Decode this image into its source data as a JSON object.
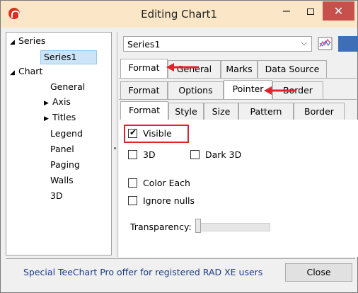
{
  "window": {
    "title": "Editing Chart1",
    "minimize_glyph": "−",
    "close_glyph": "✕",
    "icon": "teechart-app-icon"
  },
  "tree": {
    "series_root": "Series",
    "series1": "Series1",
    "chart_root": "Chart",
    "chart_items": [
      "General",
      "Axis",
      "Titles",
      "Legend",
      "Panel",
      "Paging",
      "Walls",
      "3D"
    ]
  },
  "series_select": {
    "value": "Series1"
  },
  "tabs_level1": [
    "Format",
    "General",
    "Marks",
    "Data Source"
  ],
  "tabs_level2": [
    "Format",
    "Options",
    "Pointer",
    "Border"
  ],
  "tabs_level3": [
    "Format",
    "Style",
    "Size",
    "Pattern",
    "Border"
  ],
  "checkboxes": {
    "visible": {
      "label": "Visible",
      "checked": true
    },
    "three_d": {
      "label": "3D",
      "checked": false
    },
    "dark_3d": {
      "label": "Dark 3D",
      "checked": false
    },
    "color_each": {
      "label": "Color Each",
      "checked": false
    },
    "ignore_nulls": {
      "label": "Ignore nulls",
      "checked": false
    }
  },
  "transparency": {
    "label": "Transparency:",
    "value_fraction": 0
  },
  "footer": {
    "promo": "Special TeeChart Pro offer for registered RAD XE users",
    "close_label": "Close"
  },
  "colors": {
    "titlebar": "#fbe7c8",
    "close_button": "#c7504d",
    "annotation_red": "#e0232b",
    "selection": "#cce4f7",
    "swatch_blue": "#3e6fb6"
  }
}
